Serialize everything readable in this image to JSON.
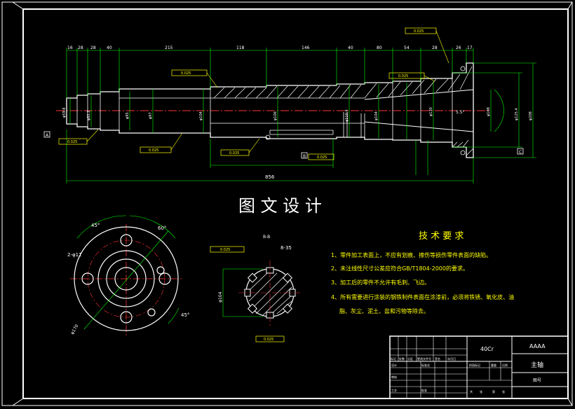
{
  "center_title": "图 文 设 计",
  "material": "40Cr",
  "project_code": "AAAA",
  "part_name": "主轴",
  "drawing_number_label": "图号",
  "tech_req": {
    "title": "技 术 要 求",
    "items": [
      "1、零件加工表面上，不应有划痕、擦伤等损伤零件表面的缺陷。",
      "2、未注线性尺寸公差应符合GB/T1804-2000的要求。",
      "3、加工后的零件不允许有毛刺、飞边。",
      "4、所有需要进行涂装的钢铁制件表面在涂漆前，必须将铁锈、氧化皮、油",
      "脂、灰尘、泥土、盐和污物等除去。"
    ]
  },
  "dimensions": {
    "top_row": [
      "16",
      "28",
      "28",
      "40",
      "215",
      "118",
      "146",
      "40",
      "80",
      "54",
      "28",
      "26",
      "17"
    ],
    "overall_length": "856",
    "diameters_left": [
      "φ59.8",
      "φ82.2",
      "φ95",
      "φ97"
    ],
    "diameters_mid": [
      "φ104",
      "φ106",
      "φ110.4",
      "φ104"
    ],
    "diameters_right": [
      "φ130",
      "φ108",
      "φ125.4",
      "φ208"
    ],
    "angle": "5.5°",
    "spline": "8-35",
    "spline_dia": "φ104",
    "hole_pattern": "2-φ11",
    "angle_45": "45°",
    "angle_60": "60°",
    "flange_dia": "φ170"
  },
  "datum_labels": [
    "A",
    "B",
    "C"
  ],
  "tolerance_frame": "0.025",
  "section_label": "B-B",
  "title_block": {
    "row_labels": [
      "标记",
      "处数",
      "分区",
      "更改文件号",
      "签名",
      "年月日"
    ],
    "sub_labels": [
      "设计",
      "标准化",
      "审核",
      "工艺",
      "批准"
    ],
    "stage_labels": [
      "阶段标记",
      "重量",
      "比例"
    ],
    "sheet_labels": [
      "共",
      "张",
      "第",
      "张"
    ]
  },
  "colors": {
    "background": "#000000",
    "outline": "#ffffff",
    "dimension": "#00ff00",
    "annotation": "#ffff00",
    "centerline": "#ff3333",
    "hatch": "#ffffff"
  }
}
